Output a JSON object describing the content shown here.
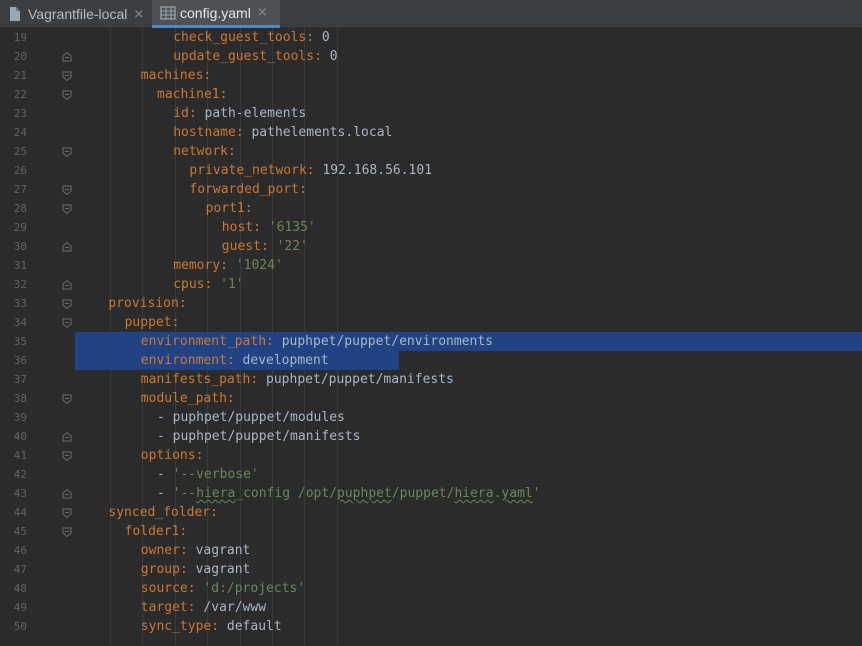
{
  "tabs": [
    {
      "label": "Vagrantfile-local",
      "icon": "file-icon",
      "active": false
    },
    {
      "label": "config.yaml",
      "icon": "yaml-file-icon",
      "active": true
    }
  ],
  "close_glyph": "×",
  "colors": {
    "key": "#cc7832",
    "value": "#a9b7c6",
    "string": "#6a8759",
    "selection": "#214283",
    "line_number": "#606366",
    "background": "#2b2b2b"
  },
  "lines": [
    {
      "n": "19",
      "indent": 12,
      "key": "check_guest_tools",
      "val": "0",
      "type": "v"
    },
    {
      "n": "20",
      "indent": 12,
      "key": "update_guest_tools",
      "val": "0",
      "type": "v"
    },
    {
      "n": "21",
      "indent": 8,
      "key": "machines",
      "val": "",
      "type": "v"
    },
    {
      "n": "22",
      "indent": 10,
      "key": "machine1",
      "val": "",
      "type": "v"
    },
    {
      "n": "23",
      "indent": 12,
      "key": "id",
      "val": "path-elements",
      "type": "v"
    },
    {
      "n": "24",
      "indent": 12,
      "key": "hostname",
      "val": "pathelements.local",
      "type": "v"
    },
    {
      "n": "25",
      "indent": 12,
      "key": "network",
      "val": "",
      "type": "v"
    },
    {
      "n": "26",
      "indent": 14,
      "key": "private_network",
      "val": "192.168.56.101",
      "type": "v"
    },
    {
      "n": "27",
      "indent": 14,
      "key": "forwarded_port",
      "val": "",
      "type": "v"
    },
    {
      "n": "28",
      "indent": 16,
      "key": "port1",
      "val": "",
      "type": "v"
    },
    {
      "n": "29",
      "indent": 18,
      "key": "host",
      "val": "'6135'",
      "type": "s"
    },
    {
      "n": "30",
      "indent": 18,
      "key": "guest",
      "val": "'22'",
      "type": "s"
    },
    {
      "n": "31",
      "indent": 12,
      "key": "memory",
      "val": "'1024'",
      "type": "s"
    },
    {
      "n": "32",
      "indent": 12,
      "key": "cpus",
      "val": "'1'",
      "type": "s"
    },
    {
      "n": "33",
      "indent": 4,
      "key": "provision",
      "val": "",
      "type": "v"
    },
    {
      "n": "34",
      "indent": 6,
      "key": "puppet",
      "val": "",
      "type": "v"
    },
    {
      "n": "35",
      "indent": 8,
      "key": "environment_path",
      "val": "puphpet/puppet/environments",
      "type": "v"
    },
    {
      "n": "36",
      "indent": 8,
      "key": "environment",
      "val": "development",
      "type": "v"
    },
    {
      "n": "37",
      "indent": 8,
      "key": "manifests_path",
      "val": "puphpet/puppet/manifests",
      "type": "v"
    },
    {
      "n": "38",
      "indent": 8,
      "key": "module_path",
      "val": "",
      "type": "v"
    },
    {
      "n": "39",
      "indent": 10,
      "dash": true,
      "val": "puphpet/puppet/modules",
      "type": "v"
    },
    {
      "n": "40",
      "indent": 10,
      "dash": true,
      "val": "puphpet/puppet/manifests",
      "type": "v"
    },
    {
      "n": "41",
      "indent": 8,
      "key": "options",
      "val": "",
      "type": "v"
    },
    {
      "n": "42",
      "indent": 10,
      "dash": true,
      "val": "'--verbose'",
      "type": "s"
    },
    {
      "n": "43",
      "indent": 10,
      "dash": true,
      "val": "'--hiera_config /opt/puphpet/puppet/hiera.yaml'",
      "type": "s"
    },
    {
      "n": "44",
      "indent": 4,
      "key": "synced_folder",
      "val": "",
      "type": "v"
    },
    {
      "n": "45",
      "indent": 6,
      "key": "folder1",
      "val": "",
      "type": "v"
    },
    {
      "n": "46",
      "indent": 8,
      "key": "owner",
      "val": "vagrant",
      "type": "v"
    },
    {
      "n": "47",
      "indent": 8,
      "key": "group",
      "val": "vagrant",
      "type": "v"
    },
    {
      "n": "48",
      "indent": 8,
      "key": "source",
      "val": "'d:/projects'",
      "type": "s"
    },
    {
      "n": "49",
      "indent": 8,
      "key": "target",
      "val": "/var/www",
      "type": "v"
    },
    {
      "n": "50",
      "indent": 8,
      "key": "sync_type",
      "val": "default",
      "type": "v"
    }
  ]
}
